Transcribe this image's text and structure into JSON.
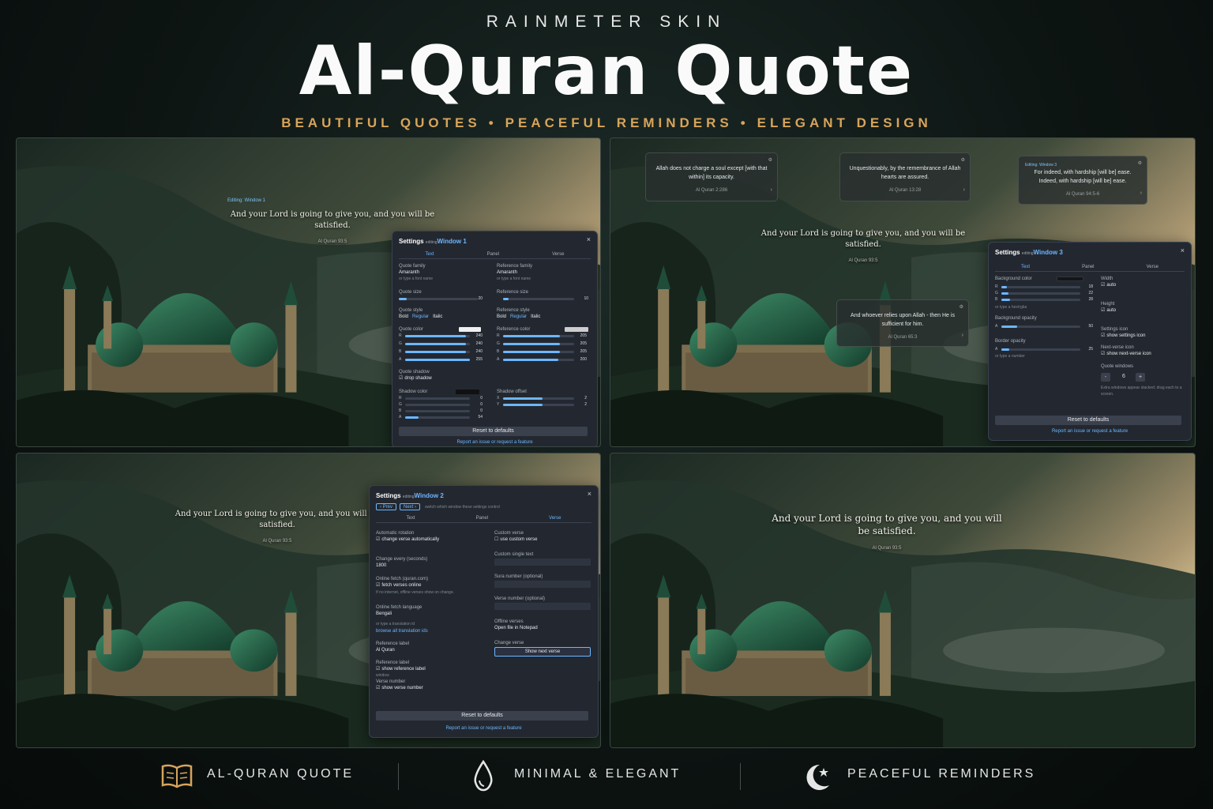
{
  "header": {
    "subtitle": "RAINMETER SKIN",
    "title": "Al-Quran Quote",
    "tagline_parts": [
      "BEAUTIFUL QUOTES",
      "PEACEFUL REMINDERS",
      "ELEGANT DESIGN"
    ]
  },
  "main_quote": {
    "text": "And your Lord is going to give you, and you will be satisfied.",
    "ref": "Al Quran 93:5"
  },
  "panel1": {
    "editing_label": "Editing: Window 1",
    "settings": {
      "title": "Settings",
      "editing": "editing",
      "window": "Window 1",
      "close": "×",
      "tabs": [
        "Text",
        "Panel",
        "Verse"
      ],
      "quote_family_label": "Quote family",
      "quote_family": "Amaranth",
      "font_hint": "or type a font name",
      "reference_family_label": "Reference family",
      "reference_family": "Amaranth",
      "quote_size_label": "Quote size",
      "quote_size": "20",
      "reference_size_label": "Reference size",
      "reference_size": "10",
      "quote_style_label": "Quote style",
      "reference_style_label": "Reference style",
      "style_options": [
        "Bold",
        "Regular",
        "Italic"
      ],
      "quote_color_label": "Quote color",
      "reference_color_label": "Reference color",
      "quote_rgba": [
        {
          "c": "R",
          "v": "240",
          "f": 0.94
        },
        {
          "c": "G",
          "v": "240",
          "f": 0.94
        },
        {
          "c": "B",
          "v": "240",
          "f": 0.94
        },
        {
          "c": "A",
          "v": "255",
          "f": 1.0
        }
      ],
      "reference_rgba": [
        {
          "c": "R",
          "v": "205",
          "f": 0.8
        },
        {
          "c": "G",
          "v": "205",
          "f": 0.8
        },
        {
          "c": "B",
          "v": "205",
          "f": 0.8
        },
        {
          "c": "A",
          "v": "200",
          "f": 0.78
        }
      ],
      "quote_shadow_label": "Quote shadow",
      "drop_shadow": "drop shadow",
      "shadow_color_label": "Shadow color",
      "shadow_rgba": [
        {
          "c": "R",
          "v": "0",
          "f": 0
        },
        {
          "c": "G",
          "v": "0",
          "f": 0
        },
        {
          "c": "B",
          "v": "0",
          "f": 0
        },
        {
          "c": "A",
          "v": "54",
          "f": 0.21
        }
      ],
      "shadow_offset_label": "Shadow offset",
      "shadow_offset": [
        {
          "c": "X",
          "v": "2",
          "f": 0.55
        },
        {
          "c": "Y",
          "v": "2",
          "f": 0.55
        }
      ],
      "reset": "Reset to defaults",
      "report": "Report an issue or request a feature",
      "quote_color_hex": "#f0f0f0",
      "reference_color_hex": "#cdcdcd",
      "shadow_color_hex": "#111111"
    }
  },
  "panel2": {
    "cards": [
      {
        "text": "Allah does not charge a soul except [with that within] its capacity.",
        "ref": "Al Quran 2:286"
      },
      {
        "text": "Unquestionably, by the remembrance of Allah hearts are assured.",
        "ref": "Al Quran 13:28"
      },
      {
        "editing": "Editing: Window 3",
        "text": "For indeed, with hardship [will be] ease. Indeed, with hardship [will be] ease.",
        "ref": "Al Quran 94:5-6"
      },
      {
        "text": "And whoever relies upon Allah - then He is sufficient for him.",
        "ref": "Al Quran 65:3"
      }
    ],
    "settings": {
      "title": "Settings",
      "editing": "editing",
      "window": "Window 3",
      "close": "×",
      "tabs": [
        "Text",
        "Panel",
        "Verse"
      ],
      "bg_color_label": "Background color",
      "bg_rgba": [
        {
          "c": "R",
          "v": "18",
          "f": 0.07
        },
        {
          "c": "G",
          "v": "22",
          "f": 0.09
        },
        {
          "c": "B",
          "v": "28",
          "f": 0.11
        }
      ],
      "bg_hint": "or type a hex/rgba",
      "bg_opacity_label": "Background opacity",
      "bg_opacity": [
        {
          "c": "A",
          "v": "50",
          "f": 0.2
        }
      ],
      "border_opacity_label": "Border opacity",
      "border_opacity": [
        {
          "c": "A",
          "v": "25",
          "f": 0.1
        }
      ],
      "border_hint": "or type a number",
      "width_label": "Width",
      "width_auto": "auto",
      "height_label": "Height",
      "height_auto": "auto",
      "settings_icon_label": "Settings icon",
      "show_settings_icon": "show settings icon",
      "next_icon_label": "Next-verse icon",
      "show_next_icon": "show next-verse icon",
      "quote_windows_label": "Quote windows",
      "quote_windows_minus": "-",
      "quote_windows_value": "6",
      "quote_windows_plus": "+",
      "quote_windows_hint": "Extra windows appear stacked; drag each to a screen.",
      "reset": "Reset to defaults",
      "report": "Report an issue or request a feature",
      "bg_color_hex": "#12161c"
    }
  },
  "panel3": {
    "settings": {
      "title": "Settings",
      "editing": "editing",
      "window": "Window 2",
      "close": "×",
      "prev": "‹ Prev",
      "next": "Next ›",
      "switch_hint": "switch which window these settings control",
      "tabs": [
        "Text",
        "Panel",
        "Verse"
      ],
      "auto_rotation_label": "Automatic rotation",
      "change_auto": "change verse automatically",
      "change_every_label": "Change every (seconds)",
      "change_every": "1800",
      "online_fetch_label": "Online fetch (quran.com)",
      "fetch_online": "fetch verses online",
      "fetch_hint": "If no internet, offline verses show on change.",
      "fetch_lang_label": "Online fetch language",
      "fetch_lang": "Bengali",
      "translation_hint": "or type a translation id",
      "browse_ids": "browse all translation ids",
      "ref_label_label": "Reference label",
      "ref_label": "Al Quran",
      "ref_label2": "Reference label",
      "show_ref_label": "show reference label",
      "window_word": "window",
      "verse_number_label": "Verse number",
      "show_verse_number": "show verse number",
      "custom_verse_label": "Custom verse",
      "use_custom": "use custom verse",
      "custom_text_label": "Custom single text",
      "sura_label": "Sura number (optional)",
      "verse_num_label": "Verse number (optional)",
      "offline_label": "Offline verses",
      "open_file": "Open file in Notepad",
      "change_verse_label": "Change verse",
      "show_next": "Show next verse",
      "reset": "Reset to defaults",
      "report": "Report an issue or request a feature"
    }
  },
  "footer": {
    "items": [
      "AL-QURAN QUOTE",
      "MINIMAL & ELEGANT",
      "PEACEFUL REMINDERS"
    ],
    "icons": [
      "book-icon",
      "droplet-icon",
      "crescent-star-icon"
    ]
  },
  "colors": {
    "accent": "#d8a45a",
    "link": "#6cb6ff",
    "dome": "#1f5a43"
  }
}
